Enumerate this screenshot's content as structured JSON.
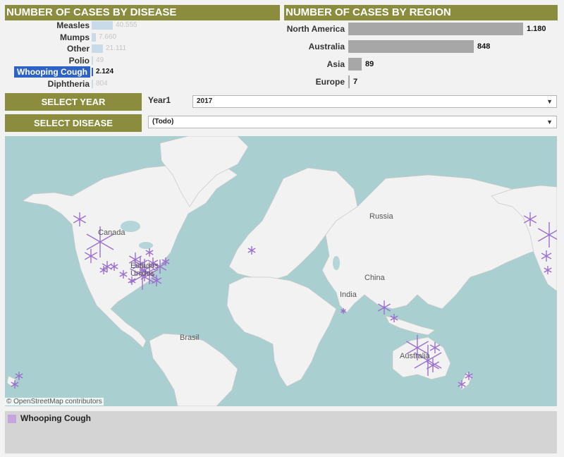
{
  "disease_panel": {
    "title": "NUMBER OF CASES BY DISEASE",
    "items": [
      {
        "label": "Measles",
        "value": "40.555",
        "count": 40555,
        "selected": false
      },
      {
        "label": "Mumps",
        "value": "7.660",
        "count": 7660,
        "selected": false
      },
      {
        "label": "Other",
        "value": "21.111",
        "count": 21111,
        "selected": false
      },
      {
        "label": "Polio",
        "value": "49",
        "count": 49,
        "selected": false
      },
      {
        "label": "Whooping Cough",
        "value": "2.124",
        "count": 2124,
        "selected": true
      },
      {
        "label": "Diphtheria",
        "value": "804",
        "count": 804,
        "selected": false
      }
    ]
  },
  "region_panel": {
    "title": "NUMBER OF CASES BY REGION",
    "items": [
      {
        "label": "North America",
        "value": "1.180",
        "count": 1180
      },
      {
        "label": "Australia",
        "value": "848",
        "count": 848
      },
      {
        "label": "Asia",
        "value": "89",
        "count": 89
      },
      {
        "label": "Europe",
        "value": "7",
        "count": 7
      }
    ]
  },
  "filters": {
    "select_year_label": "SELECT YEAR",
    "select_disease_label": "SELECT DISEASE",
    "year_caption": "Year1",
    "year_value": "2017",
    "disease_value": "(Todo)"
  },
  "map": {
    "labels": {
      "canada": "Canada",
      "usa_line1": "Estados",
      "usa_line2": "Unidos",
      "russia": "Russia",
      "china": "China",
      "india": "India",
      "brasil": "Brasil",
      "australia": "Australia"
    },
    "attribution": "© OpenStreetMap contributors",
    "water_color": "#aacfd0",
    "land_color": "#f2f2f2",
    "marker_color": "#9b6fcf"
  },
  "legend": {
    "label": "Whooping Cough",
    "color": "#c6a4e0"
  },
  "colors": {
    "title_bar": "#8c8c3e",
    "selected": "#2e63c5",
    "region_bar": "#a7a7a7",
    "disease_bar": "#c9dbe8"
  }
}
